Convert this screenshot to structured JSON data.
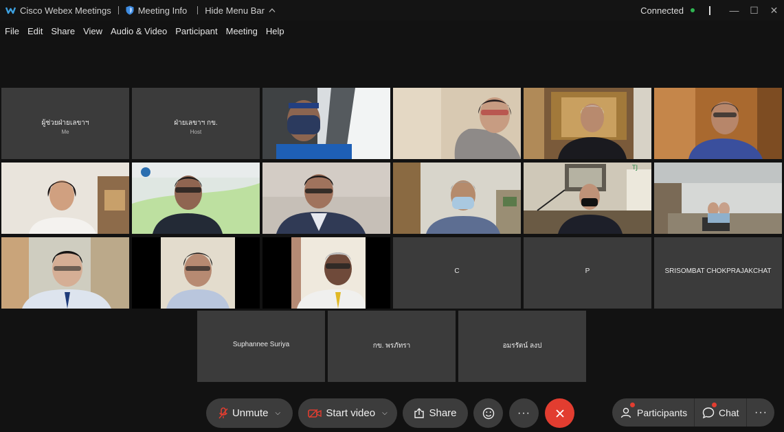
{
  "titlebar": {
    "app_name": "Cisco Webex Meetings",
    "meeting_info": "Meeting Info",
    "hide_menu": "Hide Menu Bar",
    "status": "Connected",
    "minimize": "—",
    "maximize": "☐",
    "close": "✕"
  },
  "menubar": {
    "items": [
      "File",
      "Edit",
      "Share",
      "View",
      "Audio & Video",
      "Participant",
      "Meeting",
      "Help"
    ]
  },
  "participants": [
    {
      "name": "ผู้ช่วยฝ่ายเลขาฯ",
      "sub": "Me",
      "video": false
    },
    {
      "name": "ฝ่ายเลขาฯ กข.",
      "sub": "Host",
      "video": false
    },
    {
      "name": "",
      "sub": "",
      "video": true
    },
    {
      "name": "",
      "sub": "",
      "video": true
    },
    {
      "name": "",
      "sub": "",
      "video": true
    },
    {
      "name": "",
      "sub": "",
      "video": true
    },
    {
      "name": "",
      "sub": "",
      "video": true
    },
    {
      "name": "",
      "sub": "",
      "video": true
    },
    {
      "name": "",
      "sub": "",
      "video": true
    },
    {
      "name": "",
      "sub": "",
      "video": true
    },
    {
      "name": "",
      "sub": "",
      "video": true
    },
    {
      "name": "",
      "sub": "",
      "video": true
    },
    {
      "name": "",
      "sub": "",
      "video": true
    },
    {
      "name": "",
      "sub": "",
      "video": true
    },
    {
      "name": "",
      "sub": "",
      "video": true
    },
    {
      "name": "C",
      "sub": "",
      "video": false
    },
    {
      "name": "P",
      "sub": "",
      "video": false
    },
    {
      "name": "SRISOMBAT CHOKPRAJAKCHAT",
      "sub": "",
      "video": false
    },
    {
      "name": "Suphannee Suriya",
      "sub": "",
      "video": false
    },
    {
      "name": "กข. พรภัทรา",
      "sub": "",
      "video": false
    },
    {
      "name": "อมรรัตน์ ลงป",
      "sub": "",
      "video": false
    }
  ],
  "controls": {
    "unmute": "Unmute",
    "start_video": "Start video",
    "share": "Share",
    "participants": "Participants",
    "chat": "Chat",
    "more": "···"
  },
  "colors": {
    "background": "#121212",
    "tile": "#3b3b3b",
    "end_call": "#e23d30",
    "connected_dot": "#2fb552",
    "mic_muted": "#e23d30"
  },
  "icons": {
    "app": "webex-logo-icon",
    "meeting_info": "shield-icon",
    "mic": "mic-muted-icon",
    "video": "video-off-icon",
    "share": "share-icon",
    "reactions": "emoji-icon",
    "end": "close-icon",
    "participants": "participants-icon",
    "chat": "chat-icon"
  }
}
